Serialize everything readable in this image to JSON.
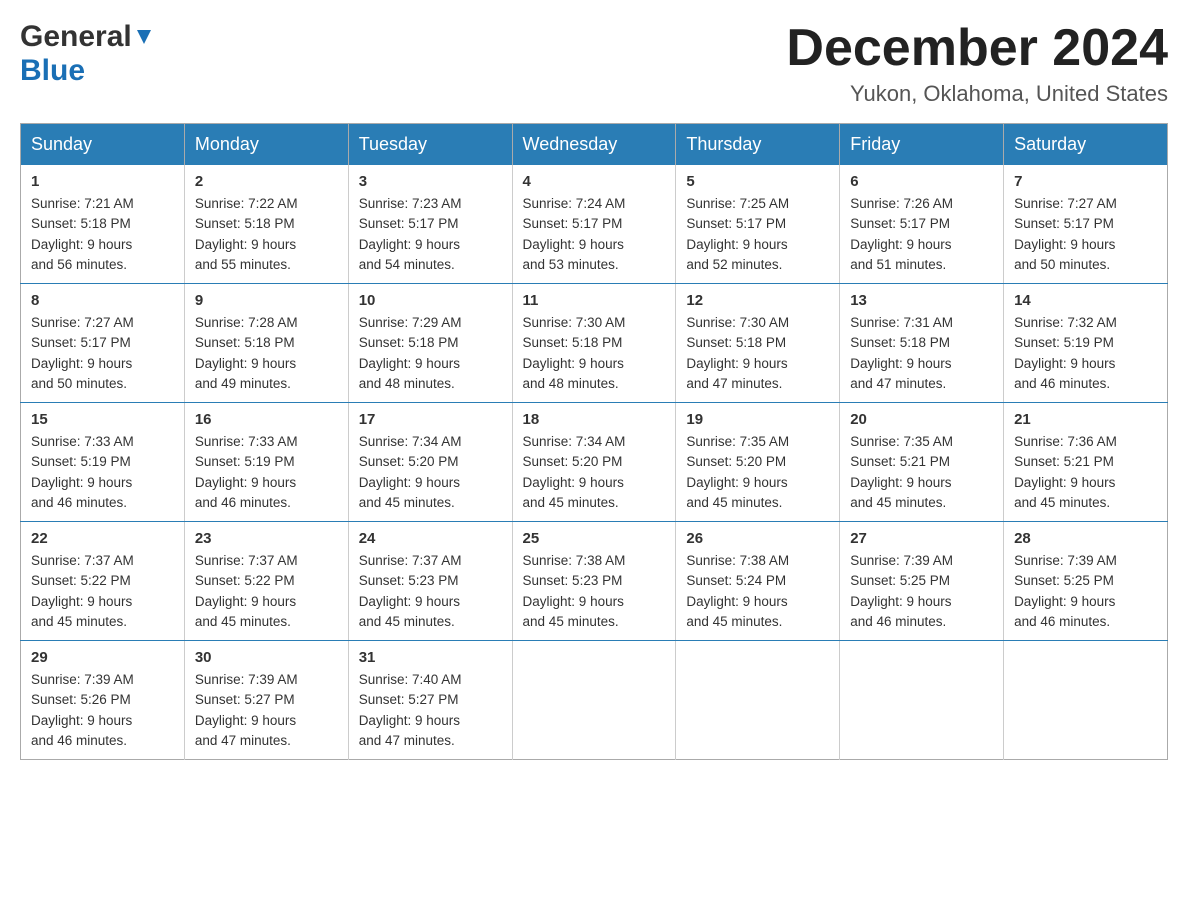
{
  "header": {
    "logo_general": "General",
    "logo_blue": "Blue",
    "month_title": "December 2024",
    "location": "Yukon, Oklahoma, United States"
  },
  "days_of_week": [
    "Sunday",
    "Monday",
    "Tuesday",
    "Wednesday",
    "Thursday",
    "Friday",
    "Saturday"
  ],
  "weeks": [
    [
      {
        "day": "1",
        "sunrise": "7:21 AM",
        "sunset": "5:18 PM",
        "daylight": "9 hours and 56 minutes."
      },
      {
        "day": "2",
        "sunrise": "7:22 AM",
        "sunset": "5:18 PM",
        "daylight": "9 hours and 55 minutes."
      },
      {
        "day": "3",
        "sunrise": "7:23 AM",
        "sunset": "5:17 PM",
        "daylight": "9 hours and 54 minutes."
      },
      {
        "day": "4",
        "sunrise": "7:24 AM",
        "sunset": "5:17 PM",
        "daylight": "9 hours and 53 minutes."
      },
      {
        "day": "5",
        "sunrise": "7:25 AM",
        "sunset": "5:17 PM",
        "daylight": "9 hours and 52 minutes."
      },
      {
        "day": "6",
        "sunrise": "7:26 AM",
        "sunset": "5:17 PM",
        "daylight": "9 hours and 51 minutes."
      },
      {
        "day": "7",
        "sunrise": "7:27 AM",
        "sunset": "5:17 PM",
        "daylight": "9 hours and 50 minutes."
      }
    ],
    [
      {
        "day": "8",
        "sunrise": "7:27 AM",
        "sunset": "5:17 PM",
        "daylight": "9 hours and 50 minutes."
      },
      {
        "day": "9",
        "sunrise": "7:28 AM",
        "sunset": "5:18 PM",
        "daylight": "9 hours and 49 minutes."
      },
      {
        "day": "10",
        "sunrise": "7:29 AM",
        "sunset": "5:18 PM",
        "daylight": "9 hours and 48 minutes."
      },
      {
        "day": "11",
        "sunrise": "7:30 AM",
        "sunset": "5:18 PM",
        "daylight": "9 hours and 48 minutes."
      },
      {
        "day": "12",
        "sunrise": "7:30 AM",
        "sunset": "5:18 PM",
        "daylight": "9 hours and 47 minutes."
      },
      {
        "day": "13",
        "sunrise": "7:31 AM",
        "sunset": "5:18 PM",
        "daylight": "9 hours and 47 minutes."
      },
      {
        "day": "14",
        "sunrise": "7:32 AM",
        "sunset": "5:19 PM",
        "daylight": "9 hours and 46 minutes."
      }
    ],
    [
      {
        "day": "15",
        "sunrise": "7:33 AM",
        "sunset": "5:19 PM",
        "daylight": "9 hours and 46 minutes."
      },
      {
        "day": "16",
        "sunrise": "7:33 AM",
        "sunset": "5:19 PM",
        "daylight": "9 hours and 46 minutes."
      },
      {
        "day": "17",
        "sunrise": "7:34 AM",
        "sunset": "5:20 PM",
        "daylight": "9 hours and 45 minutes."
      },
      {
        "day": "18",
        "sunrise": "7:34 AM",
        "sunset": "5:20 PM",
        "daylight": "9 hours and 45 minutes."
      },
      {
        "day": "19",
        "sunrise": "7:35 AM",
        "sunset": "5:20 PM",
        "daylight": "9 hours and 45 minutes."
      },
      {
        "day": "20",
        "sunrise": "7:35 AM",
        "sunset": "5:21 PM",
        "daylight": "9 hours and 45 minutes."
      },
      {
        "day": "21",
        "sunrise": "7:36 AM",
        "sunset": "5:21 PM",
        "daylight": "9 hours and 45 minutes."
      }
    ],
    [
      {
        "day": "22",
        "sunrise": "7:37 AM",
        "sunset": "5:22 PM",
        "daylight": "9 hours and 45 minutes."
      },
      {
        "day": "23",
        "sunrise": "7:37 AM",
        "sunset": "5:22 PM",
        "daylight": "9 hours and 45 minutes."
      },
      {
        "day": "24",
        "sunrise": "7:37 AM",
        "sunset": "5:23 PM",
        "daylight": "9 hours and 45 minutes."
      },
      {
        "day": "25",
        "sunrise": "7:38 AM",
        "sunset": "5:23 PM",
        "daylight": "9 hours and 45 minutes."
      },
      {
        "day": "26",
        "sunrise": "7:38 AM",
        "sunset": "5:24 PM",
        "daylight": "9 hours and 45 minutes."
      },
      {
        "day": "27",
        "sunrise": "7:39 AM",
        "sunset": "5:25 PM",
        "daylight": "9 hours and 46 minutes."
      },
      {
        "day": "28",
        "sunrise": "7:39 AM",
        "sunset": "5:25 PM",
        "daylight": "9 hours and 46 minutes."
      }
    ],
    [
      {
        "day": "29",
        "sunrise": "7:39 AM",
        "sunset": "5:26 PM",
        "daylight": "9 hours and 46 minutes."
      },
      {
        "day": "30",
        "sunrise": "7:39 AM",
        "sunset": "5:27 PM",
        "daylight": "9 hours and 47 minutes."
      },
      {
        "day": "31",
        "sunrise": "7:40 AM",
        "sunset": "5:27 PM",
        "daylight": "9 hours and 47 minutes."
      },
      null,
      null,
      null,
      null
    ]
  ],
  "labels": {
    "sunrise": "Sunrise:",
    "sunset": "Sunset:",
    "daylight": "Daylight:"
  }
}
